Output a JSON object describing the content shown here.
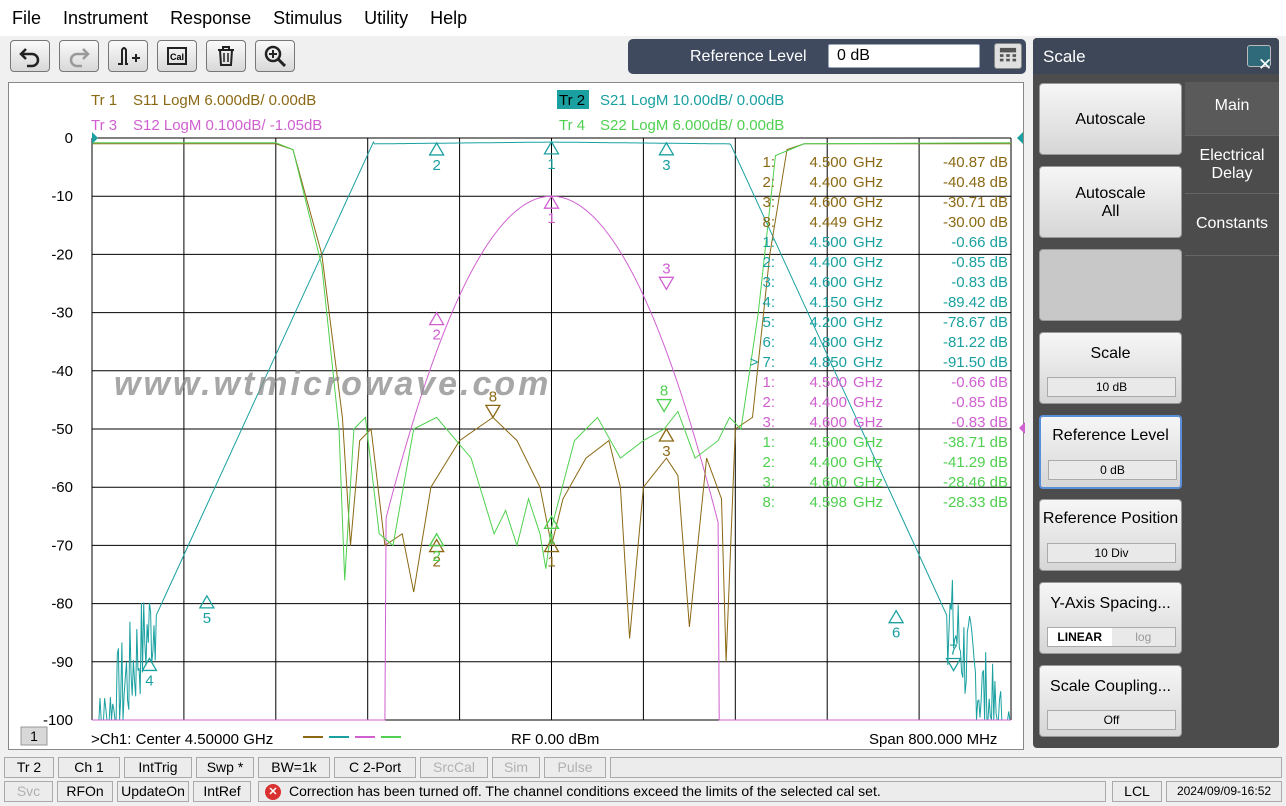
{
  "menu": [
    "File",
    "Instrument",
    "Response",
    "Stimulus",
    "Utility",
    "Help"
  ],
  "toolbar": {
    "icons": [
      "undo-icon",
      "redo-icon",
      "marker-add-icon",
      "cal-icon",
      "trash-icon",
      "zoom-icon"
    ],
    "ref_level_label": "Reference Level",
    "ref_level_value": "0 dB"
  },
  "traces": [
    {
      "id": "Tr 1",
      "text": "S11 LogM 6.000dB/  0.00dB",
      "color": "#8b6914"
    },
    {
      "id": "Tr 2",
      "text": "S21 LogM 10.00dB/  0.00dB",
      "color": "#1aa0a0"
    },
    {
      "id": "Tr 3",
      "text": "S12 LogM 0.100dB/  -1.05dB",
      "color": "#d060d0"
    },
    {
      "id": "Tr 4",
      "text": "S22 LogM 6.000dB/  0.00dB",
      "color": "#50d050"
    }
  ],
  "y_ticks": [
    "0",
    "-10",
    "-20",
    "-30",
    "-40",
    "-50",
    "-60",
    "-70",
    "-80",
    "-90",
    "-100"
  ],
  "watermark": "www.wtmicrowave.com",
  "marker_table": [
    {
      "n": "1:",
      "f": "4.500",
      "u": "GHz",
      "v": "-40.87 dB",
      "c": "#8b6914"
    },
    {
      "n": "2:",
      "f": "4.400",
      "u": "GHz",
      "v": "-40.48 dB",
      "c": "#8b6914"
    },
    {
      "n": "3:",
      "f": "4.600",
      "u": "GHz",
      "v": "-30.71 dB",
      "c": "#8b6914"
    },
    {
      "n": "8:",
      "f": "4.449",
      "u": "GHz",
      "v": "-30.00 dB",
      "c": "#8b6914"
    },
    {
      "n": "1:",
      "f": "4.500",
      "u": "GHz",
      "v": "-0.66 dB",
      "c": "#1aa0a0"
    },
    {
      "n": "2:",
      "f": "4.400",
      "u": "GHz",
      "v": "-0.85 dB",
      "c": "#1aa0a0"
    },
    {
      "n": "3:",
      "f": "4.600",
      "u": "GHz",
      "v": "-0.83 dB",
      "c": "#1aa0a0"
    },
    {
      "n": "4:",
      "f": "4.150",
      "u": "GHz",
      "v": "-89.42 dB",
      "c": "#1aa0a0"
    },
    {
      "n": "5:",
      "f": "4.200",
      "u": "GHz",
      "v": "-78.67 dB",
      "c": "#1aa0a0"
    },
    {
      "n": "6:",
      "f": "4.800",
      "u": "GHz",
      "v": "-81.22 dB",
      "c": "#1aa0a0"
    },
    {
      "n": "> 7:",
      "f": "4.850",
      "u": "GHz",
      "v": "-91.50 dB",
      "c": "#1aa0a0"
    },
    {
      "n": "1:",
      "f": "4.500",
      "u": "GHz",
      "v": "-0.66 dB",
      "c": "#d060d0"
    },
    {
      "n": "2:",
      "f": "4.400",
      "u": "GHz",
      "v": "-0.85 dB",
      "c": "#d060d0"
    },
    {
      "n": "3:",
      "f": "4.600",
      "u": "GHz",
      "v": "-0.83 dB",
      "c": "#d060d0"
    },
    {
      "n": "1:",
      "f": "4.500",
      "u": "GHz",
      "v": "-38.71 dB",
      "c": "#50d050"
    },
    {
      "n": "2:",
      "f": "4.400",
      "u": "GHz",
      "v": "-41.29 dB",
      "c": "#50d050"
    },
    {
      "n": "3:",
      "f": "4.600",
      "u": "GHz",
      "v": "-28.46 dB",
      "c": "#50d050"
    },
    {
      "n": "8:",
      "f": "4.598",
      "u": "GHz",
      "v": "-28.33 dB",
      "c": "#50d050"
    }
  ],
  "footer": {
    "channel": "1",
    "center": ">Ch1:  Center   4.50000 GHz",
    "rf": "RF     0.00 dBm",
    "span": "Span  800.000 MHz"
  },
  "panel": {
    "title": "Scale",
    "close": "✕",
    "tabs": [
      "Main",
      "Electrical Delay",
      "Constants"
    ],
    "softkeys": {
      "autoscale": "Autoscale",
      "autoscale_all": "Autoscale All",
      "scale": "Scale",
      "scale_val": "10 dB",
      "ref_level": "Reference Level",
      "ref_level_val": "0 dB",
      "ref_pos": "Reference Position",
      "ref_pos_val": "10 Div",
      "y_spacing": "Y-Axis Spacing...",
      "linear": "LINEAR",
      "log": "log",
      "coupling": "Scale Coupling...",
      "coupling_val": "Off"
    }
  },
  "status1": [
    "Tr 2",
    "Ch 1",
    "IntTrig",
    "Swp *",
    "BW=1k",
    "C  2-Port",
    "SrcCal",
    "Sim",
    "Pulse"
  ],
  "status2": {
    "svc": "Svc",
    "rfon": "RFOn",
    "update": "UpdateOn",
    "intref": "IntRef",
    "message": "Correction has been turned off. The channel conditions exceed the limits of the selected cal set.",
    "lcl": "LCL",
    "datetime": "2024/09/09-16:52"
  }
}
